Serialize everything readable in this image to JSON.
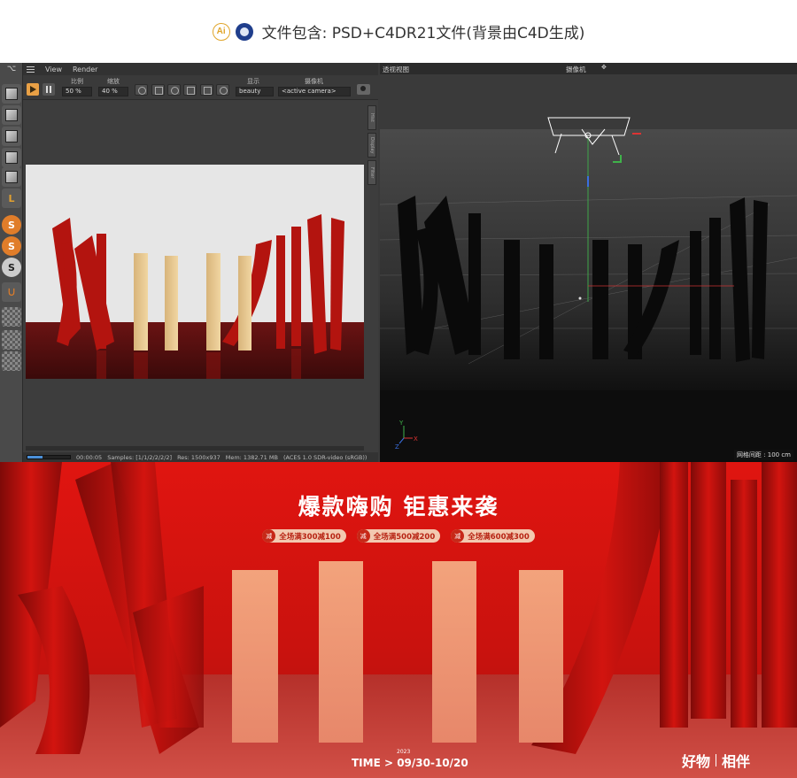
{
  "caption": {
    "text": "文件包含: PSD+C4DR21文件(背景由C4D生成)",
    "ai_badge": "Ai"
  },
  "picture_viewer": {
    "menu": {
      "view": "View",
      "render": "Render"
    },
    "toolbar": {
      "ratio_label": "比例",
      "ratio_value": "50 %",
      "zoom_label": "缩放",
      "zoom_value": "40 %",
      "display_label": "显示",
      "display_value": "beauty",
      "camera_label": "摄像机",
      "camera_value": "<active camera>"
    },
    "side_tabs": [
      "Hist",
      "Display",
      "Filter"
    ],
    "status": {
      "time": "00:00:05",
      "samples": "Samples: [1/1/2/2/2/2]",
      "res": "Res: 1500x937",
      "mem": "Mem: 1382.71 MB",
      "color": "(ACES 1.0 SDR-video (sRGB))",
      "progress": 0.35
    }
  },
  "viewport": {
    "title": "透视视图",
    "camera": "摄像机",
    "grid_readout": "网格间距 : 100 cm",
    "axis_y": "Y",
    "axis_z": "Z",
    "axis_x": "X"
  },
  "left_toolbar": {
    "icons": [
      "cube-icon",
      "checker-cube-icon",
      "edge-cube-icon",
      "face-cube-icon",
      "solid-cube-icon",
      "angle-icon",
      "spline-icon",
      "sculpt-icon",
      "sculpt-icon",
      "magnet-icon",
      "grid-icon",
      "lock-grid-icon",
      "checker-icon"
    ]
  },
  "banner": {
    "title": "爆款嗨购 钜惠来袭",
    "coupons": [
      {
        "mark": "减",
        "text": "全场满300减100"
      },
      {
        "mark": "减",
        "text": "全场满500减200"
      },
      {
        "mark": "减",
        "text": "全场满600减300"
      }
    ],
    "year": "2023",
    "time": "TIME > 09/30-10/20",
    "brand_left": "好物",
    "brand_right": "相伴",
    "colors": {
      "red": "#c4140e",
      "bar": "#f0a07a"
    }
  }
}
